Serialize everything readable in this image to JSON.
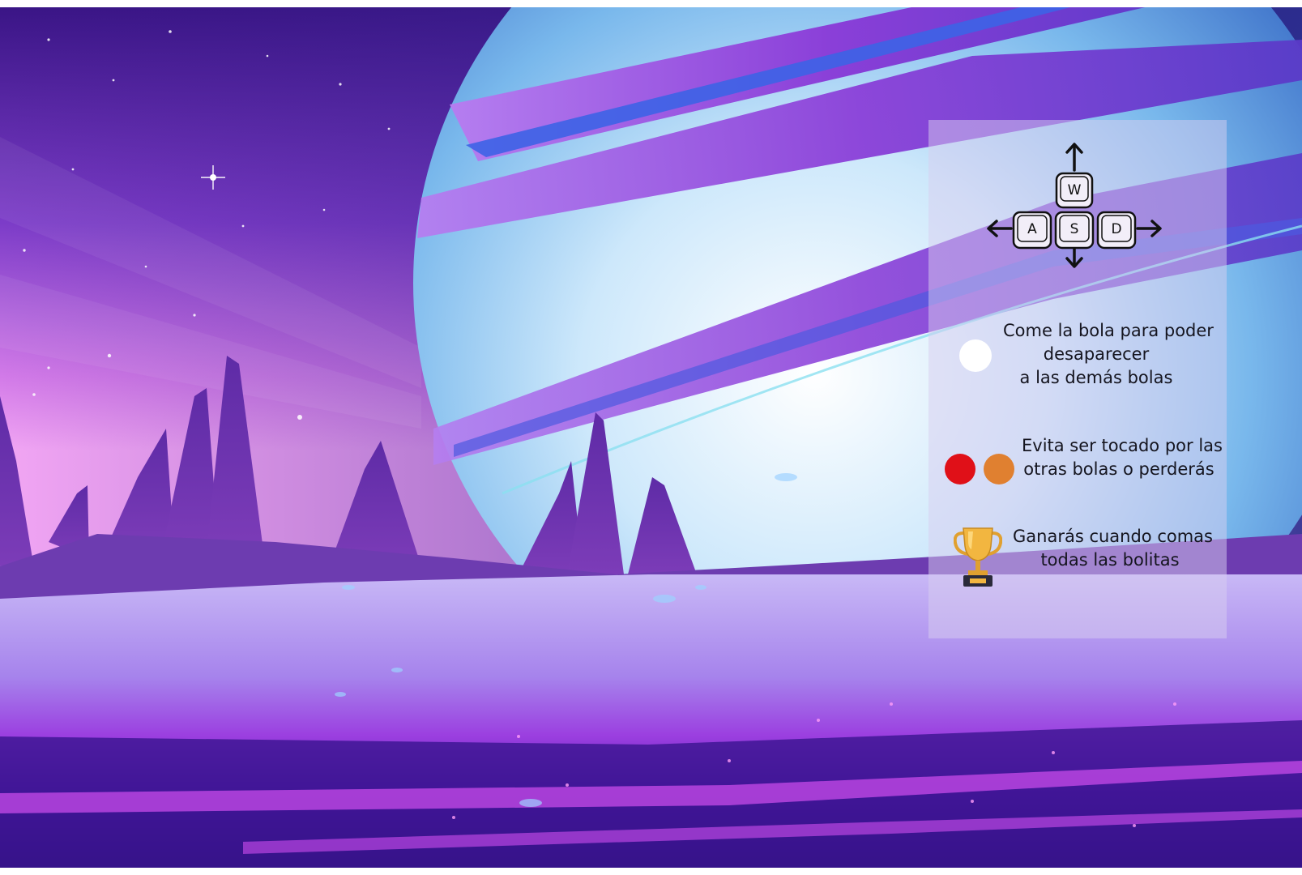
{
  "controls": {
    "icon": "wasd-keys-with-arrows-icon",
    "keys": {
      "up": "W",
      "left": "A",
      "down": "S",
      "right": "D"
    }
  },
  "rules": [
    {
      "icon": "white-ball-icon",
      "lines": [
        "Come la bola para poder",
        "desaparecer",
        "a las demás bolas"
      ]
    },
    {
      "icon": "red-orange-balls-icon",
      "lines": [
        "Evita ser tocado por las",
        "otras bolas o perderás"
      ]
    },
    {
      "icon": "trophy-icon",
      "lines": [
        "Ganarás cuando comas",
        "todas las bolitas"
      ]
    }
  ],
  "colors": {
    "sky_top": "#3a1586",
    "sky_glow": "#f09cf4",
    "planet_light": "#e8f4ff",
    "planet_blue": "#4a8fdc",
    "ring_purple": "#8a3fd8",
    "ground": "#b8a8f0",
    "ball_white": "#ffffff",
    "ball_red": "#e01018",
    "ball_orange": "#e08030",
    "trophy_gold": "#f2b640"
  }
}
